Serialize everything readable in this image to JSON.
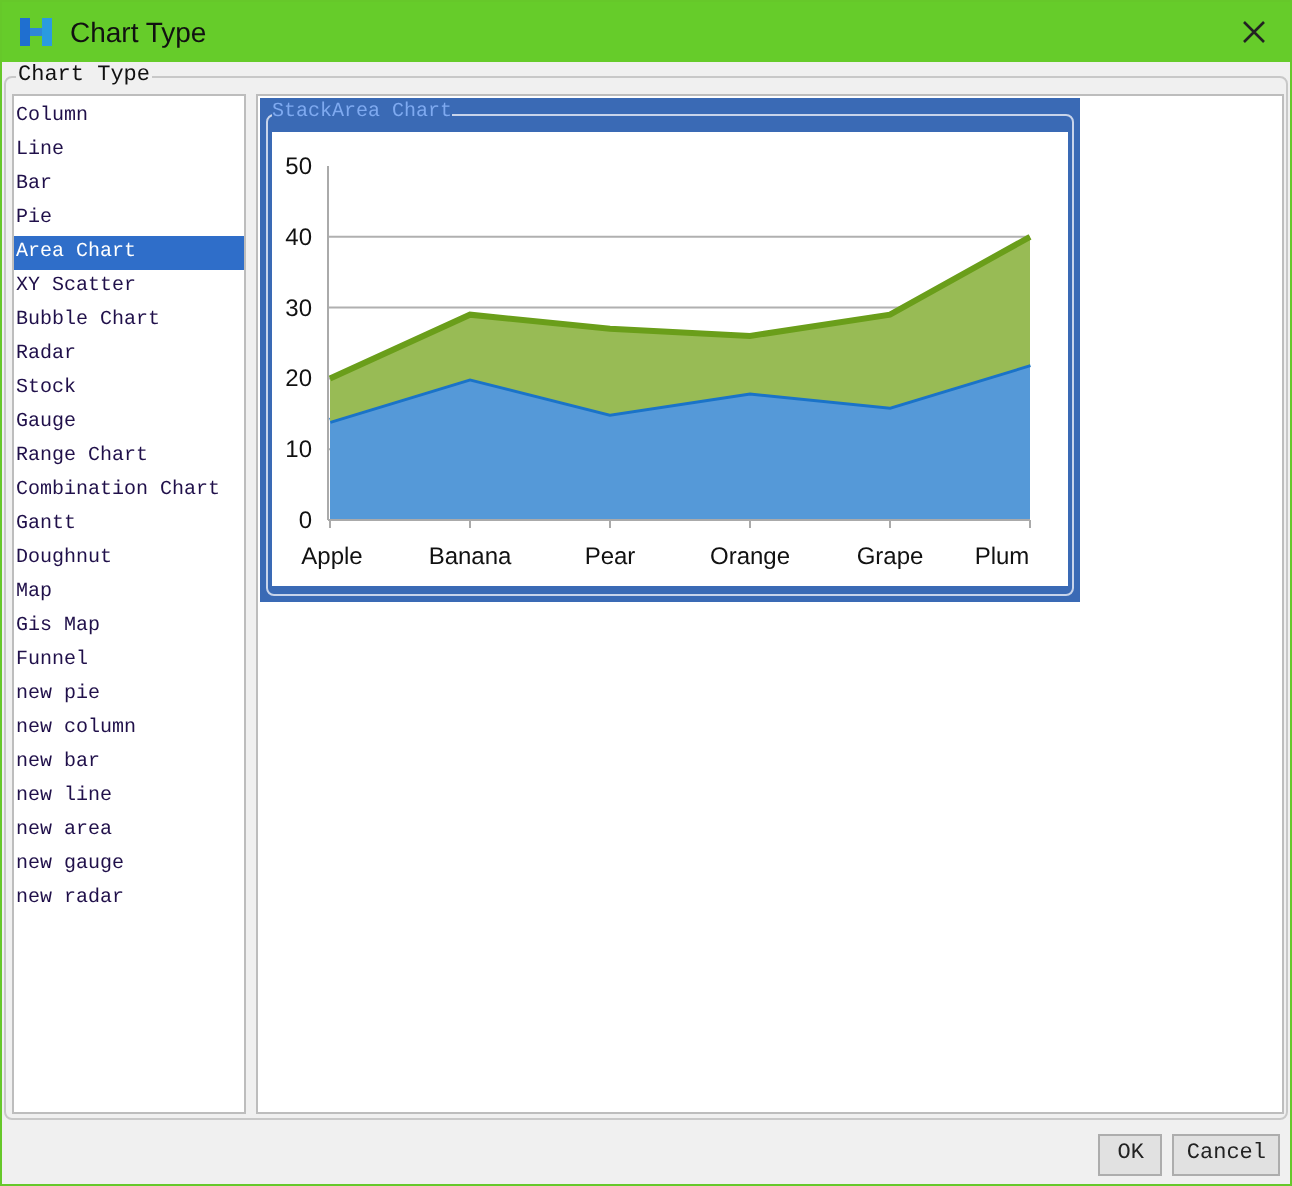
{
  "window": {
    "title": "Chart Type"
  },
  "group_title": "Chart Type",
  "chart_types": [
    {
      "label": "Column",
      "selected": false
    },
    {
      "label": "Line",
      "selected": false
    },
    {
      "label": "Bar",
      "selected": false
    },
    {
      "label": "Pie",
      "selected": false
    },
    {
      "label": "Area Chart",
      "selected": true
    },
    {
      "label": "XY Scatter",
      "selected": false
    },
    {
      "label": "Bubble Chart",
      "selected": false
    },
    {
      "label": "Radar",
      "selected": false
    },
    {
      "label": "Stock",
      "selected": false
    },
    {
      "label": "Gauge",
      "selected": false
    },
    {
      "label": "Range Chart",
      "selected": false
    },
    {
      "label": "Combination Chart",
      "selected": false
    },
    {
      "label": "Gantt",
      "selected": false
    },
    {
      "label": "Doughnut",
      "selected": false
    },
    {
      "label": "Map",
      "selected": false
    },
    {
      "label": "Gis Map",
      "selected": false
    },
    {
      "label": "Funnel",
      "selected": false
    },
    {
      "label": "new pie",
      "selected": false
    },
    {
      "label": "new column",
      "selected": false
    },
    {
      "label": "new bar",
      "selected": false
    },
    {
      "label": "new line",
      "selected": false
    },
    {
      "label": "new area",
      "selected": false
    },
    {
      "label": "new gauge",
      "selected": false
    },
    {
      "label": "new radar",
      "selected": false
    }
  ],
  "preview": {
    "title": "StackArea Chart",
    "chart_data": {
      "type": "area",
      "stacked": true,
      "categories": [
        "Apple",
        "Banana",
        "Pear",
        "Orange",
        "Grape",
        "Plum"
      ],
      "series": [
        {
          "color": "#1a73c8",
          "values": [
            14,
            20,
            15,
            18,
            16,
            22
          ]
        },
        {
          "color": "#6a9e1a",
          "values": [
            6,
            9,
            12,
            8,
            13,
            18
          ]
        }
      ],
      "ylim": [
        0,
        50
      ],
      "grid": true,
      "yticks": [
        0,
        10,
        20,
        30,
        40,
        50
      ]
    }
  },
  "buttons": [
    "OK",
    "Cancel"
  ]
}
